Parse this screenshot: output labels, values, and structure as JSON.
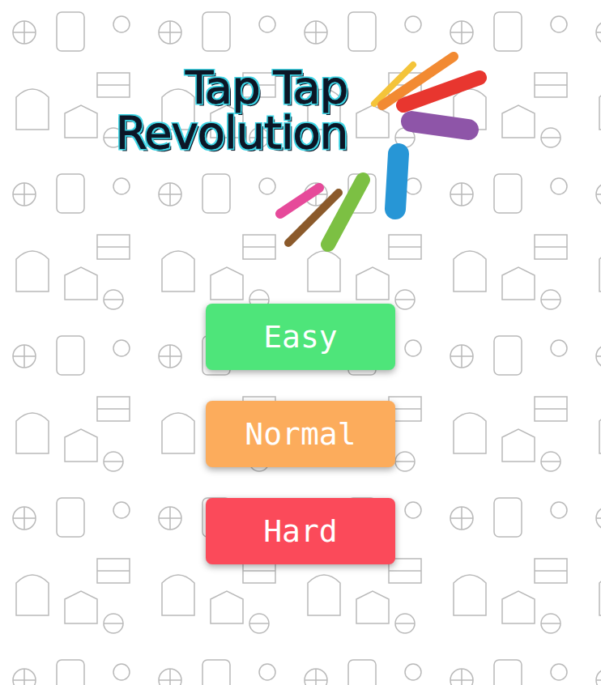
{
  "logo": {
    "lines": [
      "Tap Tap",
      "Revolution"
    ]
  },
  "buttons": [
    {
      "label": "Easy",
      "color": "#4ee57a"
    },
    {
      "label": "Normal",
      "color": "#fcac5c"
    },
    {
      "label": "Hard",
      "color": "#fb4a5a"
    }
  ]
}
